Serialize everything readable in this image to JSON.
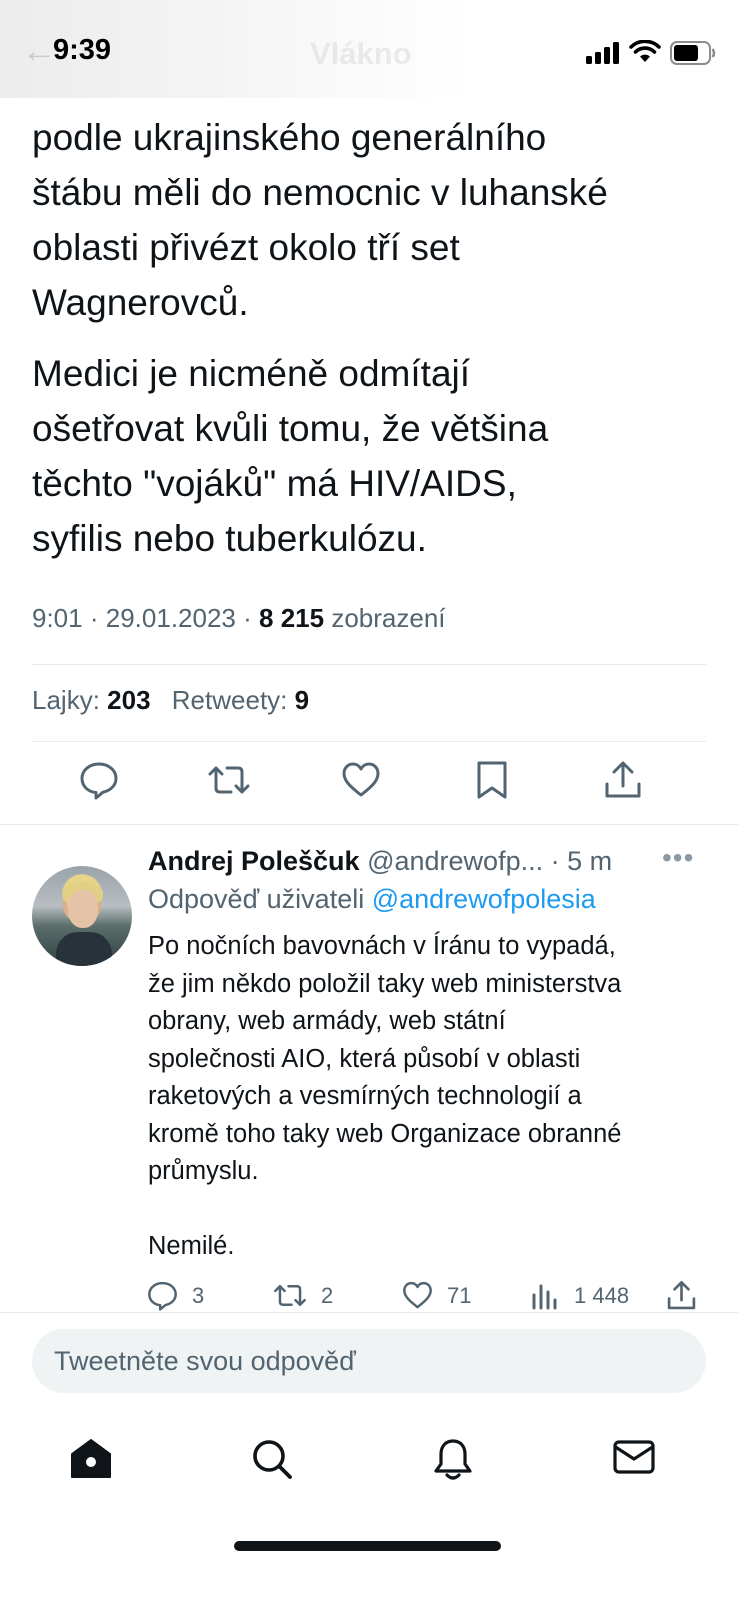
{
  "status_bar": {
    "time": "9:39",
    "ghost_title": "Vlákno",
    "ghost_back": "←"
  },
  "tweet": {
    "paragraphs": [
      "podle ukrajinského generálního\nštábu měli do nemocnic v luhanské\noblasti přivézt okolo tří set\nWagnerovců.",
      "Medici je nicméně odmítají\nošetřovat kvůli tomu, že většina\ntěchto \"vojáků\" má HIV/AIDS,\nsyfilis nebo tuberkulózu."
    ],
    "time": "9:01",
    "date": "29.01.2023",
    "separator": "·",
    "views_count": "8 215",
    "views_label": "zobrazení",
    "likes_label": "Lajky:",
    "likes_count": "203",
    "retweets_label": "Retweety:",
    "retweets_count": "9"
  },
  "reply": {
    "name": "Andrej Poleščuk",
    "handle": "@andrewofp...",
    "time": "· 5 m",
    "more": "•••",
    "replying_prefix": "Odpověď uživateli",
    "replying_to": "@andrewofpolesia",
    "text": "Po nočních bavovnách v Íránu to vypadá,\nže jim někdo položil taky web ministerstva\nobrany, web armády, web státní\nspolečnosti AIO, která působí v oblasti\nraketových a vesmírných technologií a\nkromě toho taky web Organizace obranné\nprůmyslu.\n\nNemilé.",
    "replies": "3",
    "retweets": "2",
    "likes": "71",
    "views": "1 448"
  },
  "compose": {
    "placeholder": "Tweetněte svou odpověď"
  },
  "tabs": [
    "home-icon",
    "search-icon",
    "bell-icon",
    "mail-icon"
  ],
  "colors": {
    "accent": "#1d9bf0",
    "text": "#0f1419",
    "secondary": "#536471",
    "divider": "#e6ecf0",
    "input_bg": "#eff3f4"
  }
}
